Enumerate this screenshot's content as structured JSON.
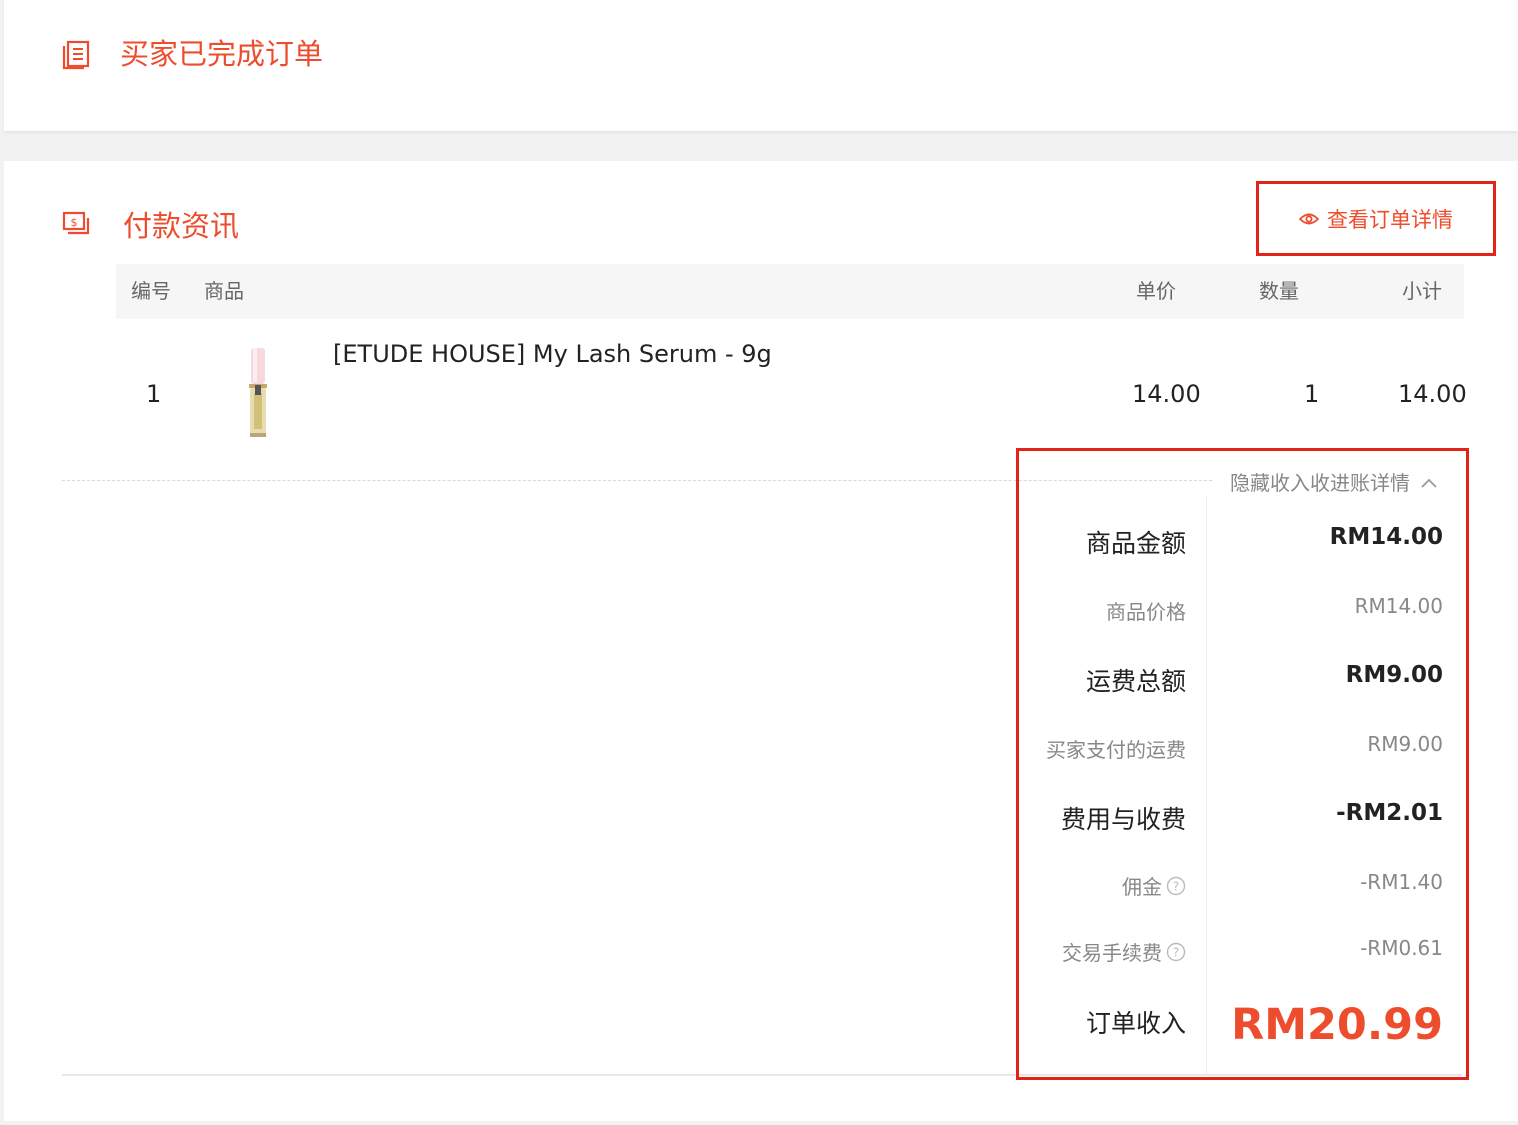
{
  "status": {
    "title": "买家已完成订单"
  },
  "payment": {
    "title": "付款资讯",
    "view_details_label": "查看订单详情",
    "table": {
      "headers": {
        "no": "编号",
        "product": "商品",
        "unit_price": "单价",
        "quantity": "数量",
        "subtotal": "小计"
      },
      "rows": [
        {
          "no": "1",
          "product_name": "[ETUDE HOUSE] My Lash Serum - 9g",
          "unit_price": "14.00",
          "quantity": "1",
          "subtotal": "14.00"
        }
      ]
    },
    "income": {
      "toggle_label": "隐藏收入收进账详情",
      "product_amount_label": "商品金额",
      "product_amount_value": "RM14.00",
      "product_price_label": "商品价格",
      "product_price_value": "RM14.00",
      "shipping_total_label": "运费总额",
      "shipping_total_value": "RM9.00",
      "buyer_shipping_label": "买家支付的运费",
      "buyer_shipping_value": "RM9.00",
      "fees_label": "费用与收费",
      "fees_value": "-RM2.01",
      "commission_label": "佣金",
      "commission_value": "-RM1.40",
      "transaction_fee_label": "交易手续费",
      "transaction_fee_value": "-RM0.61",
      "order_income_label": "订单收入",
      "order_income_value": "RM20.99"
    }
  },
  "colors": {
    "accent": "#ee4d2d",
    "highlight_border": "#e2231a"
  },
  "icons": [
    "order-list-icon",
    "payment-icon",
    "eye-icon",
    "chevron-up-icon",
    "help-circle-icon"
  ]
}
